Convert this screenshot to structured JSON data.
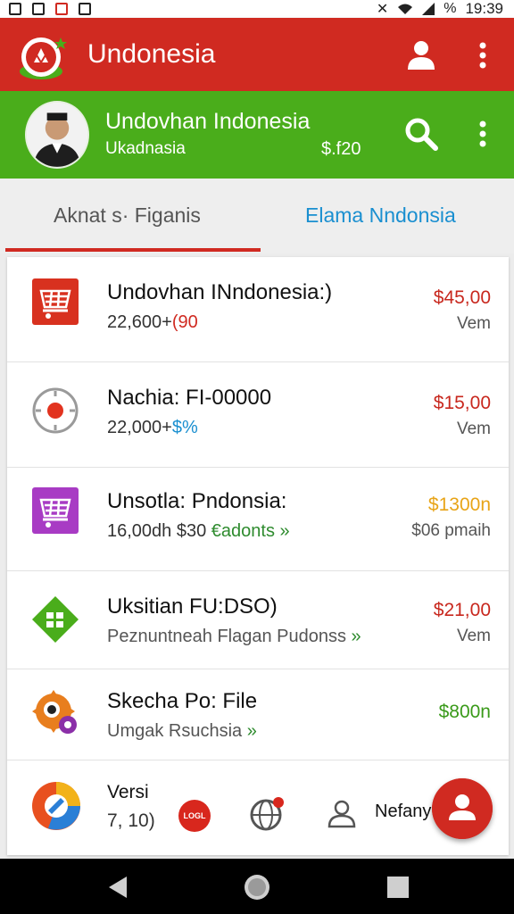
{
  "status_bar": {
    "time": "19:39",
    "battery": "%"
  },
  "app_bar": {
    "title": "Undonesia"
  },
  "profile": {
    "name": "Undovhan Indonesia",
    "subtitle": "Ukadnasia",
    "amount": "$.f20"
  },
  "tabs": [
    {
      "label": "Aknat s· Figanis",
      "active": true
    },
    {
      "label": "Elama Nndonsia",
      "active": false
    }
  ],
  "list": [
    {
      "title": "Undovhan INndonesia:)",
      "sub_value": "22,600+",
      "sub_accent": "(90",
      "price": "$45,00",
      "unit": "Vem",
      "price_color": "#c8281e",
      "accent_color": "#d02a21",
      "icon": "cart-icon"
    },
    {
      "title": "Nachia: FI-00000",
      "sub_value": "22,000+",
      "sub_accent": "$%",
      "price": "$15,00",
      "unit": "Vem",
      "price_color": "#c8281e",
      "accent_color": "#1a8fd0",
      "icon": "target-icon"
    },
    {
      "title": "Unsotla: Pndonsia:",
      "sub_value": "16,00dh $30",
      "sub_accent": "€adonts »",
      "price": "$1300n",
      "unit": "$06 pmaih",
      "price_color": "#e8a417",
      "accent_color": "#2e8b2e",
      "icon": "basket-icon"
    },
    {
      "title": "Uksitian FU:DSO)",
      "sub_value": "Peznuntneah Flagan Pudonss",
      "sub_accent": "»",
      "price": "$21,00",
      "unit": "Vem",
      "price_color": "#c8281e",
      "accent_color": "#2e8b2e",
      "icon": "grid-diamond-icon"
    },
    {
      "title": "Skecha Po: File",
      "sub_value": "Umgak Rsuchsia",
      "sub_accent": "»",
      "price": "$800n",
      "unit": "",
      "price_color": "#3a9a1a",
      "accent_color": "#2e8b2e",
      "icon": "gear-eye-icon"
    }
  ],
  "bottom": {
    "versi": "Versi",
    "version": "7, 10)",
    "badge": "LOGL",
    "name": "Nefany"
  }
}
